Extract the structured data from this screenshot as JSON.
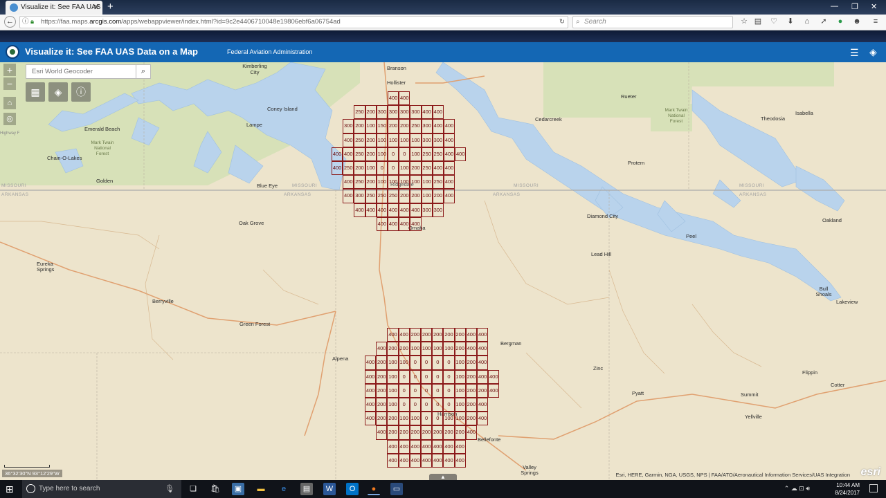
{
  "browser": {
    "tab_title": "Visualize it: See FAA UAS Da",
    "url_prefix": "https://faa.maps.",
    "url_domain": "arcgis.com",
    "url_rest": "/apps/webappviewer/index.html?id=9c2e4406710048e19806ebf6a06754ad",
    "search_placeholder": "Search"
  },
  "app": {
    "title": "Visualize it: See FAA UAS Data on a Map",
    "subtitle": "Federal Aviation Administration"
  },
  "map": {
    "geocoder_placeholder": "Esri World Geocoder",
    "zoom_in": "+",
    "zoom_out": "−",
    "coords": "36°32'30\"N 93°12'29\"W",
    "attribution": "Esri, HERE, Garmin, NGA, USGS, NPS | FAA/ATO/Aeronautical Information Services/UAS Integration",
    "esri": "esri",
    "state_labels": [
      "MISSOURI",
      "MISSOURI",
      "MISSOURI",
      "MISSOURI",
      "ARKANSAS",
      "ARKANSAS",
      "ARKANSAS",
      "ARKANSAS"
    ],
    "places": [
      "Branson",
      "Hollister",
      "Kimberling City",
      "Coney Island",
      "Lampe",
      "Emerald Beach",
      "Mark Twain National Forest",
      "Chain-O-Lakes",
      "Golden",
      "Blue Eye",
      "Oak Grove",
      "Eureka Springs",
      "Berryville",
      "Green Forest",
      "Alpena",
      "Omaha",
      "Ridgedale",
      "Rueter",
      "Cedarcreek",
      "Mark Twain National Forest",
      "Isabella",
      "Theodosia",
      "Protem",
      "Diamond City",
      "Lead Hill",
      "Peel",
      "Oakland",
      "Bull Shoals",
      "Lakeview",
      "Bergman",
      "Zinc",
      "Pyatt",
      "Summit",
      "Yellville",
      "Flippin",
      "Cotter",
      "Harrison",
      "Bellefonte",
      "Valley Springs",
      "Highway F"
    ]
  },
  "grid_north": {
    "rows": [
      {
        "start": 5,
        "values": [
          "400",
          "400"
        ]
      },
      {
        "start": 2,
        "values": [
          "250",
          "200",
          "300",
          "300",
          "300",
          "300",
          "400",
          "400"
        ]
      },
      {
        "start": 1,
        "values": [
          "300",
          "200",
          "100",
          "150",
          "200",
          "200",
          "250",
          "300",
          "400",
          "400"
        ]
      },
      {
        "start": 1,
        "values": [
          "400",
          "250",
          "200",
          "100",
          "100",
          "100",
          "100",
          "300",
          "300",
          "400"
        ]
      },
      {
        "start": 0,
        "values": [
          "400",
          "400",
          "250",
          "200",
          "100",
          "0",
          "0",
          "100",
          "250",
          "250",
          "400",
          "400"
        ]
      },
      {
        "start": 0,
        "values": [
          "400",
          "250",
          "200",
          "100",
          "0",
          "0",
          "100",
          "200",
          "250",
          "400",
          "400"
        ]
      },
      {
        "start": 1,
        "values": [
          "400",
          "250",
          "200",
          "100",
          "100",
          "100",
          "100",
          "100",
          "250",
          "400"
        ]
      },
      {
        "start": 1,
        "values": [
          "400",
          "300",
          "250",
          "250",
          "250",
          "200",
          "200",
          "100",
          "200",
          "400"
        ]
      },
      {
        "start": 2,
        "values": [
          "400",
          "400",
          "400",
          "400",
          "400",
          "400",
          "300",
          "300"
        ]
      },
      {
        "start": 4,
        "values": [
          "400",
          "400",
          "400",
          "400"
        ]
      }
    ]
  },
  "grid_south": {
    "rows": [
      {
        "start": 2,
        "values": [
          "400",
          "400",
          "200",
          "200",
          "200",
          "200",
          "200",
          "400",
          "400"
        ]
      },
      {
        "start": 1,
        "values": [
          "400",
          "200",
          "200",
          "100",
          "100",
          "100",
          "100",
          "200",
          "400",
          "400"
        ]
      },
      {
        "start": 0,
        "values": [
          "400",
          "200",
          "100",
          "100",
          "0",
          "0",
          "0",
          "0",
          "100",
          "200",
          "400"
        ]
      },
      {
        "start": 0,
        "values": [
          "400",
          "200",
          "100",
          "0",
          "0",
          "0",
          "0",
          "0",
          "100",
          "200",
          "400",
          "400"
        ]
      },
      {
        "start": 0,
        "values": [
          "400",
          "200",
          "100",
          "0",
          "0",
          "0",
          "0",
          "0",
          "100",
          "200",
          "200",
          "400"
        ]
      },
      {
        "start": 0,
        "values": [
          "400",
          "200",
          "100",
          "0",
          "0",
          "0",
          "0",
          "0",
          "100",
          "200",
          "400"
        ]
      },
      {
        "start": 0,
        "values": [
          "400",
          "200",
          "200",
          "100",
          "100",
          "0",
          "0",
          "100",
          "100",
          "200",
          "400"
        ]
      },
      {
        "start": 1,
        "values": [
          "400",
          "200",
          "200",
          "200",
          "200",
          "200",
          "200",
          "200",
          "400"
        ]
      },
      {
        "start": 2,
        "values": [
          "400",
          "400",
          "400",
          "400",
          "400",
          "400",
          "400"
        ]
      },
      {
        "start": 2,
        "values": [
          "400",
          "400",
          "400",
          "400",
          "400",
          "400",
          "400"
        ]
      }
    ]
  },
  "taskbar": {
    "search_placeholder": "Type here to search",
    "time": "10:44 AM",
    "date": "8/24/2017"
  },
  "colors": {
    "header": "#1467b4",
    "grid_line": "#8b1a1a",
    "map_land": "#ede4cc",
    "water": "#b9d3ec",
    "forest": "#d7e1b8"
  }
}
